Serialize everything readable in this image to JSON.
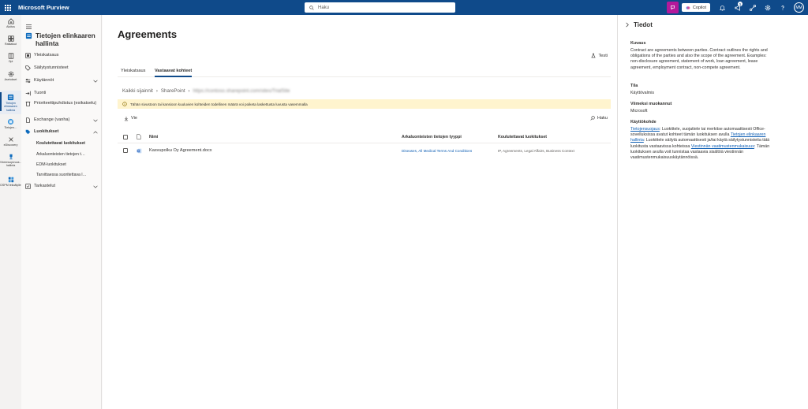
{
  "app": {
    "title": "Microsoft Purview"
  },
  "search": {
    "placeholder": "Haku"
  },
  "topbar": {
    "copilot_label": "Copilot",
    "notification_count": "1",
    "avatar_initials": "MM"
  },
  "rail": [
    {
      "label": "Aloitus",
      "icon": "home-icon"
    },
    {
      "label": "Ratkaisut",
      "icon": "grid-icon"
    },
    {
      "label": "Opi",
      "icon": "book-icon"
    },
    {
      "label": "Asetukset",
      "icon": "gear-icon"
    },
    {
      "label": "Tietojen elinkaaren hallinta",
      "icon": "lifecycle-icon",
      "active": true
    },
    {
      "label": "Tietojen…",
      "icon": "data-icon"
    },
    {
      "label": "eDiscovery",
      "icon": "ediscovery-icon"
    },
    {
      "label": "Yhteensopivuus…hallinta",
      "icon": "trophy-icon"
    },
    {
      "label": "DSPM tekoälylle",
      "icon": "dspm-icon"
    }
  ],
  "nav": {
    "title": "Tietojen elinkaaren hallinta",
    "items": [
      {
        "label": "Yleiskatsaus",
        "icon": "overview-icon"
      },
      {
        "label": "Säilytystunnisteet",
        "icon": "tag-icon"
      },
      {
        "label": "Käytännöt",
        "icon": "policy-icon",
        "expandable": true
      },
      {
        "label": "Tuonti",
        "icon": "import-icon"
      },
      {
        "label": "Prioriteettipuhdistus (esikatselu)",
        "icon": "cleanup-icon"
      },
      {
        "label": "Exchange (vanha)",
        "icon": "exchange-icon",
        "expandable": true
      },
      {
        "label": "Luokitukset",
        "icon": "classifier-icon",
        "expandable": true,
        "expanded": true
      },
      {
        "label": "Tarkastelut",
        "icon": "review-icon",
        "expandable": true
      }
    ],
    "subitems": [
      "Koulutettavat luokitukset",
      "Arkaluonteisten tietojen t…",
      "EDM-luokitukset",
      "Tarvittaessa suoritettava l…"
    ]
  },
  "main": {
    "title": "Agreements",
    "test_label": "Testi",
    "tabs": [
      "Yleiskatsaus",
      "Vastaavat kohteet"
    ],
    "breadcrumb": [
      "Kaikki sijainnit",
      "SharePoint",
      "https://contoso.sharepoint.com/sites/TrialSite"
    ],
    "warning": "Tähän sivustoon tai kansioon kuuluvien kohteiden todellinen määrä voi poiketa laskettusta luvusta vasemmalla",
    "toolbar": {
      "export_label": "Vie",
      "search_label": "Haku"
    },
    "table": {
      "columns": [
        "Nimi",
        "Arkaluonteisten tietojen tyyppi",
        "Koulutettavat luokitukset"
      ],
      "rows": [
        {
          "name": "Kasvupolku Oy Agreement.docx",
          "sit": "Diseases, All Medical Terms And Conditions",
          "classifiers": "IP, Agreements, Legal Affairs, Business Context"
        }
      ]
    }
  },
  "panel": {
    "title": "Tiedot",
    "desc_label": "Kuvaus",
    "desc": "Contract are agreements between parties. Contract outlines the rights and obligations of the parties and also the scope of the agreement. Examples: non-disclosure agreement, statement of work, loan agreement, lease agreement, employment contract, non-compete agreement.",
    "state_label": "Tila",
    "state": "Käyttövalmis",
    "modified_label": "Viimeksi muokannut",
    "modified": "Microsoft",
    "usage_label": "Käyttökohde",
    "usage_link1": "Tietojensuojaus",
    "usage_text1": ": Luokittele, suojattele tai merkitse automaattisesti Office-sovelluksissa avatut kohteet tämän luokituksen avulla",
    "usage_link2": "Tietojen elinkaaren hallinta",
    "usage_text2": ": Luokittele säilytä automaattisesti ja/tai käytä säilytystunnisteita tätä luokitusta vastaavissa kohteissa",
    "usage_link3": "Viestinnän vaatimustenmukaisuus",
    "usage_text3": ": Tämän luokituksen avulla voit tunnistaa vastaavia sisältöä viestinnän vaatimustenmukaisuuskäytännöissä."
  }
}
